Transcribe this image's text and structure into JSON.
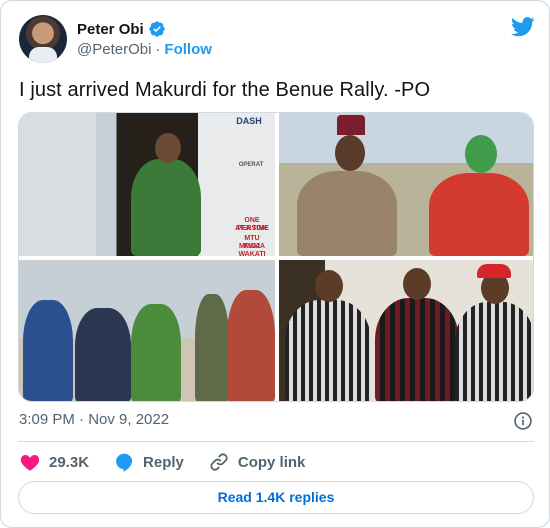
{
  "author": {
    "display_name": "Peter Obi",
    "handle": "@PeterObi",
    "separator": "·",
    "follow_label": "Follow"
  },
  "tweet": {
    "text": "I just arrived Makurdi for the Benue Rally. -PO",
    "timestamp": "3:09 PM · Nov 9, 2022"
  },
  "media": {
    "photo1_caption_lines": [
      "ONE PERSON",
      "AT A TIME",
      "MTU MMOJA",
      "KWA WAKATI"
    ],
    "photo1_plane_lettering": [
      "DASH",
      "OPERAT"
    ]
  },
  "actions": {
    "likes_count": "29.3K",
    "reply_label": "Reply",
    "copy_link_label": "Copy link"
  },
  "footer": {
    "read_replies_label": "Read 1.4K replies"
  },
  "colors": {
    "accent": "#1d9bf0",
    "like": "#f91880",
    "muted": "#536471",
    "border": "#cfd9de"
  }
}
